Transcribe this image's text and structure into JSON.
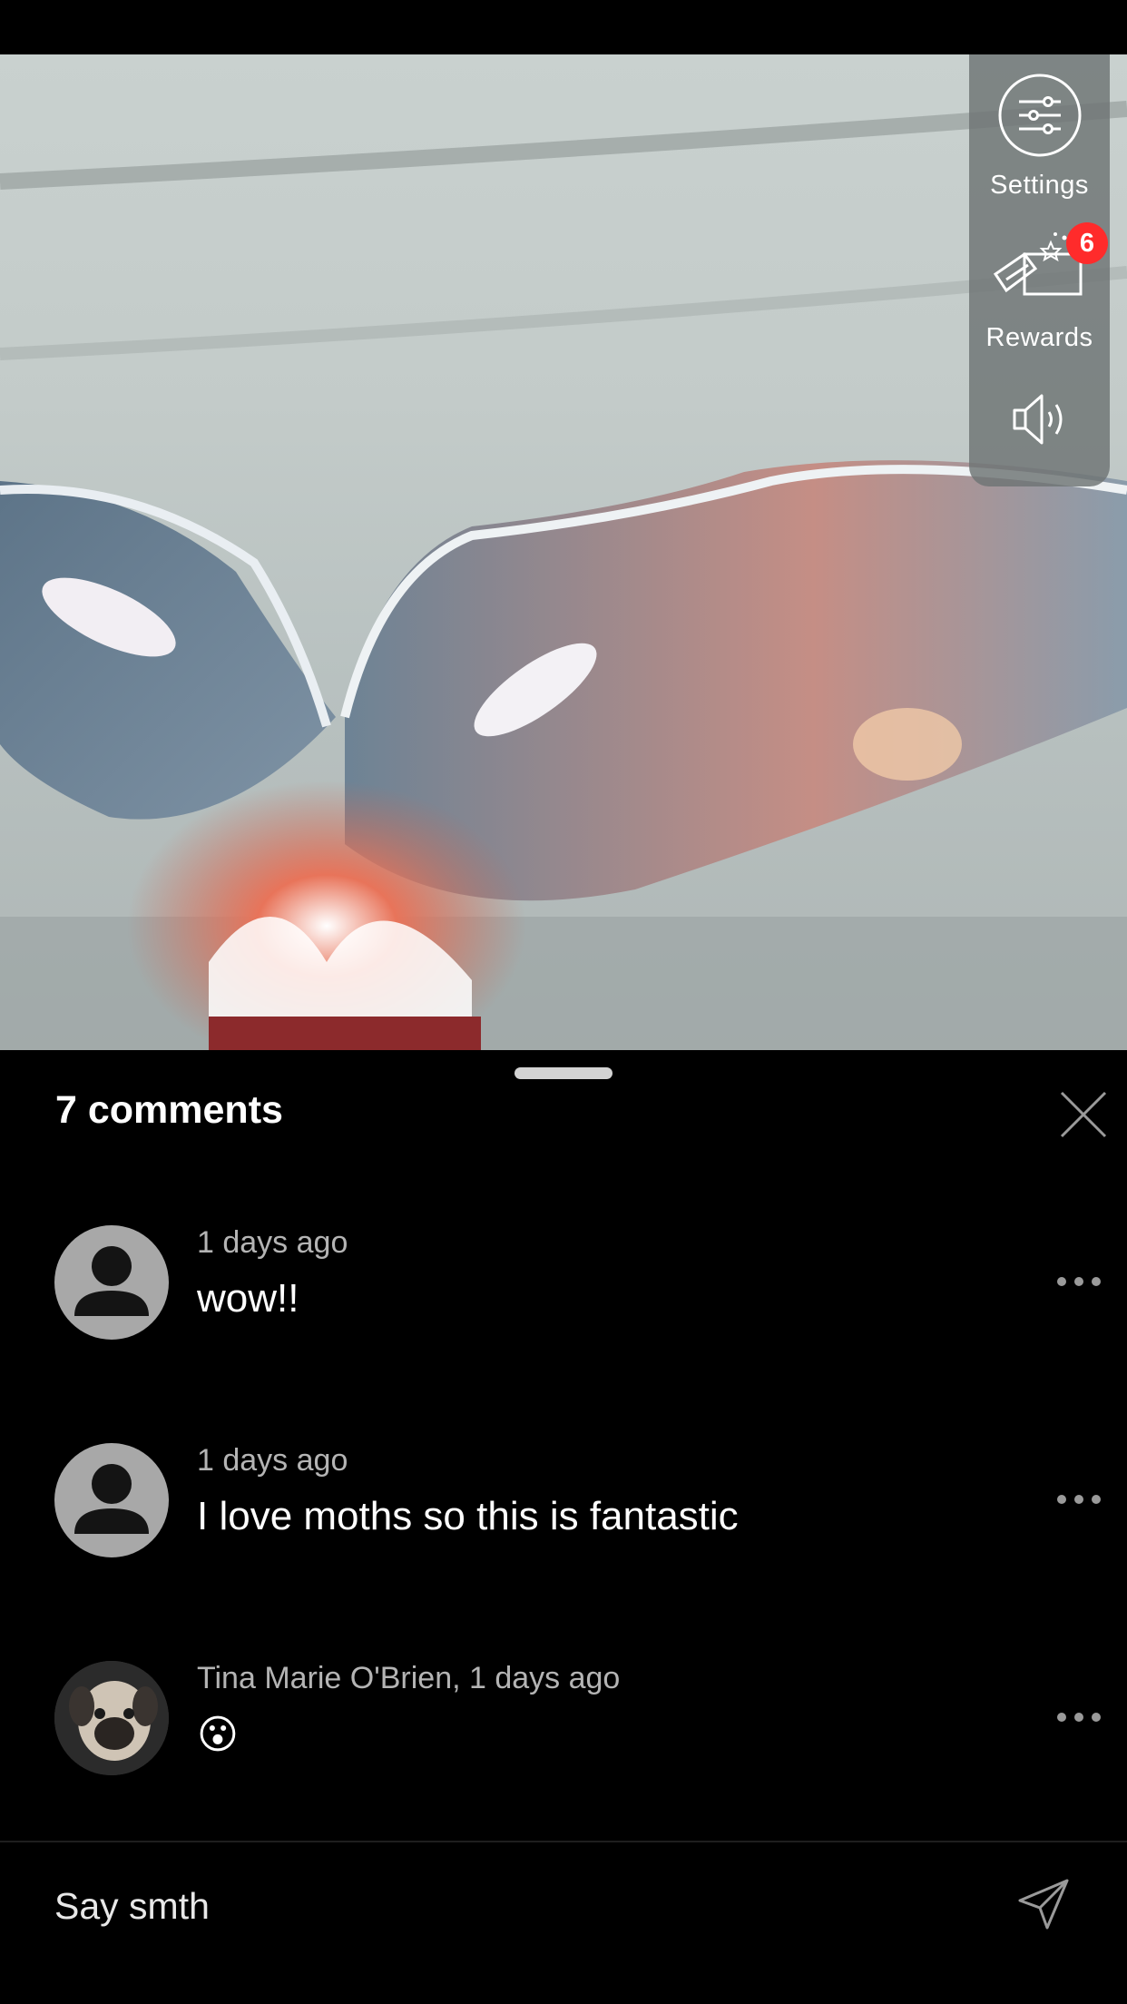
{
  "side_panel": {
    "settings_label": "Settings",
    "rewards_label": "Rewards",
    "rewards_badge": "6",
    "settings_icon": "sliders-icon",
    "rewards_icon": "gift-box-icon",
    "sound_icon": "speaker-icon"
  },
  "comments": {
    "count_label": "7 comments",
    "items": [
      {
        "meta": "1 days ago",
        "text": "wow!!",
        "avatar": "default-person"
      },
      {
        "meta": "1 days ago",
        "text": "I love moths so this is fantastic",
        "avatar": "default-person"
      },
      {
        "meta": "Tina Marie O'Brien, 1 days ago",
        "text": "😮",
        "avatar": "pug-photo"
      }
    ]
  },
  "input": {
    "placeholder": "Say smth",
    "send_icon": "send-icon"
  },
  "colors": {
    "badge": "#ff2b2b",
    "sheet_background": "#000000",
    "panel_background": "#6e7474"
  }
}
